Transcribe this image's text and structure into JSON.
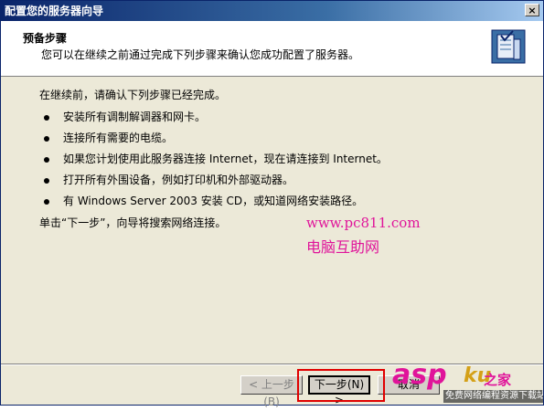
{
  "window": {
    "title": "配置您的服务器向导",
    "close_glyph": "×"
  },
  "header": {
    "title": "预备步骤",
    "subtitle": "您可以在继续之前通过完成下列步骤来确认您成功配置了服务器。",
    "icon": "server-wizard-icon"
  },
  "content": {
    "intro": "在继续前，请确认下列步骤已经完成。",
    "steps": [
      "安装所有调制解调器和网卡。",
      "连接所有需要的电缆。",
      "如果您计划使用此服务器连接 Internet，现在请连接到 Internet。",
      "打开所有外围设备，例如打印机和外部驱动器。",
      "有 Windows Server 2003 安装 CD，或知道网络安装路径。"
    ],
    "outro": "单击“下一步”，向导将搜索网络连接。"
  },
  "buttons": {
    "back": "< 上一步(B)",
    "next": "下一步(N) >",
    "cancel": "取消"
  },
  "watermark": {
    "url": "www.pc811.com",
    "name": "电脑互助网",
    "logo_asp": "asp",
    "logo_ku": "ku",
    "logo_home": "之家",
    "caption": "免费网络编程资源下载站!"
  },
  "colors": {
    "title_bar": "#0a246a",
    "watermark": "#e0149a",
    "highlight": "#e00000"
  }
}
